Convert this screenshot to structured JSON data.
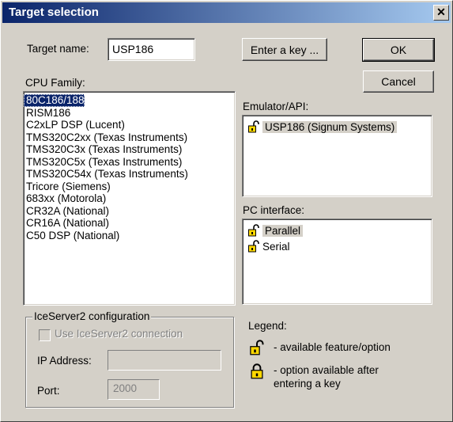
{
  "window": {
    "title": "Target selection",
    "close_glyph": "✕"
  },
  "target": {
    "label": "Target name:",
    "value": "USP186"
  },
  "buttons": {
    "enter_key": "Enter a key ...",
    "ok": "OK",
    "cancel": "Cancel"
  },
  "cpu": {
    "label": "CPU Family:",
    "items": [
      "80C186/188",
      "RISM186",
      "C2xLP DSP (Lucent)",
      "TMS320C2xx (Texas Instruments)",
      "TMS320C3x (Texas Instruments)",
      "TMS320C5x (Texas Instruments)",
      "TMS320C54x (Texas Instruments)",
      "Tricore (Siemens)",
      "683xx (Motorola)",
      "CR32A (National)",
      "CR16A (National)",
      "C50 DSP (National)"
    ],
    "selected_index": 0
  },
  "emulator": {
    "label": "Emulator/API:",
    "items": [
      "USP186 (Signum Systems)"
    ]
  },
  "pc_interface": {
    "label": "PC interface:",
    "items": [
      "Parallel",
      "Serial"
    ]
  },
  "iceserver": {
    "title": "IceServer2 configuration",
    "use_label": "Use IceServer2 connection",
    "ip_label": "IP Address:",
    "ip_value": "",
    "port_label": "Port:",
    "port_value": "2000"
  },
  "legend": {
    "title": "Legend:",
    "available": "- available feature/option",
    "key_line1": "- option available after",
    "key_line2": "entering a key"
  },
  "colors": {
    "selection": "#0a246a",
    "face": "#d4d0c8",
    "lock_yellow": "#ffd800"
  }
}
